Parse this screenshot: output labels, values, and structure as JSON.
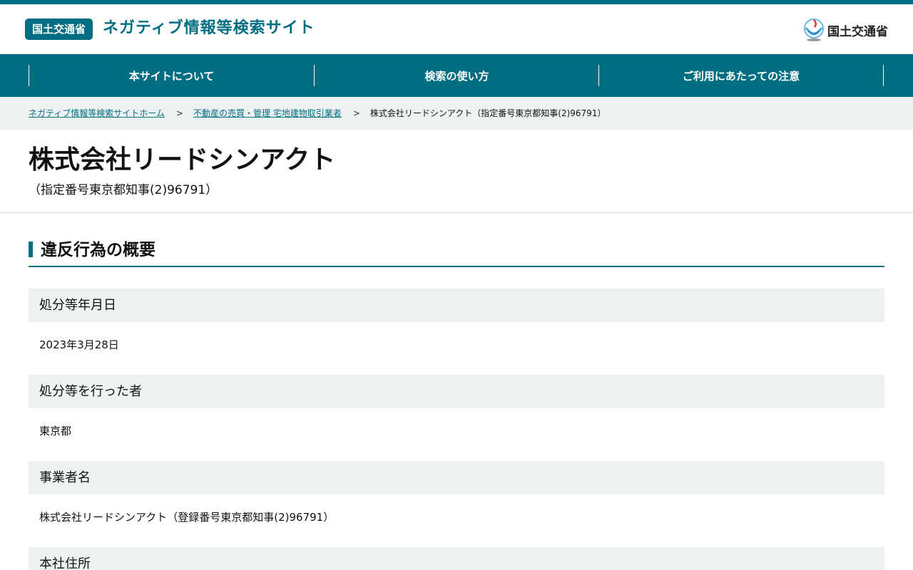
{
  "header": {
    "badge": "国土交通省",
    "site_title": "ネガティブ情報等検索サイト",
    "ministry_name": "国土交通省"
  },
  "nav": [
    {
      "label": "本サイトについて"
    },
    {
      "label": "検索の使い方"
    },
    {
      "label": "ご利用にあたっての注意"
    }
  ],
  "breadcrumb": {
    "home": "ネガティブ情報等検索サイトホーム",
    "category": "不動産の売買・管理 宅地建物取引業者",
    "current": "株式会社リードシンアクト（指定番号東京都知事(2)96791）",
    "separator": ">"
  },
  "page": {
    "title": "株式会社リードシンアクト",
    "subtitle": "（指定番号東京都知事(2)96791）"
  },
  "section": {
    "title": "違反行為の概要"
  },
  "details": [
    {
      "label": "処分等年月日",
      "value": "2023年3月28日"
    },
    {
      "label": "処分等を行った者",
      "value": "東京都"
    },
    {
      "label": "事業者名",
      "value": "株式会社リードシンアクト（登録番号東京都知事(2)96791）"
    },
    {
      "label": "本社住所",
      "value": ""
    }
  ],
  "colors": {
    "primary": "#006e82",
    "label_bg": "#eef2f3"
  }
}
